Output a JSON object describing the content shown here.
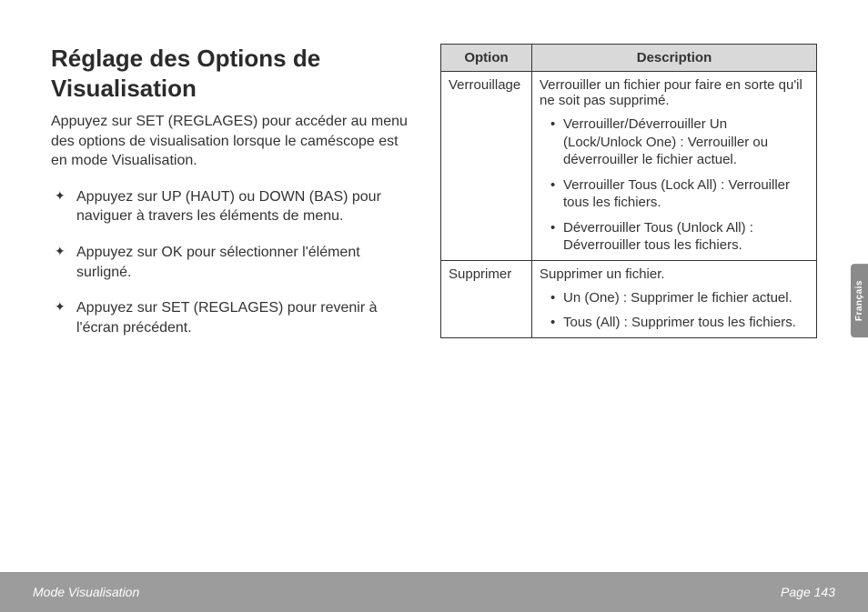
{
  "heading": "Réglage des Options de Visualisation",
  "intro": "Appuyez sur SET (REGLAGES) pour accéder au menu des options de visualisation lorsque le caméscope est en mode Visualisation.",
  "bullets": [
    "Appuyez sur UP (HAUT) ou DOWN (BAS) pour naviguer à travers les éléments de menu.",
    "Appuyez sur OK pour sélectionner l'élément surligné.",
    "Appuyez sur SET (REGLAGES) pour revenir à l'écran précédent."
  ],
  "table": {
    "headers": [
      "Option",
      "Description"
    ],
    "rows": [
      {
        "option": "Verrouillage",
        "desc_intro": "Verrouiller un fichier pour faire en sorte qu'il ne soit pas supprimé.",
        "items": [
          "Verrouiller/Déverrouiller Un (Lock/Unlock One) : Verrouiller ou déverrouiller le fichier actuel.",
          "Verrouiller Tous (Lock All) : Verrouiller tous les fichiers.",
          "Déverrouiller Tous (Unlock All) : Déverrouiller tous les fichiers."
        ]
      },
      {
        "option": "Supprimer",
        "desc_intro": "Supprimer un fichier.",
        "items": [
          "Un (One) : Supprimer le fichier actuel.",
          "Tous (All) : Supprimer tous les fichiers."
        ]
      }
    ]
  },
  "side_tab": "Français",
  "footer": {
    "left": "Mode Visualisation",
    "right": "Page 143"
  }
}
